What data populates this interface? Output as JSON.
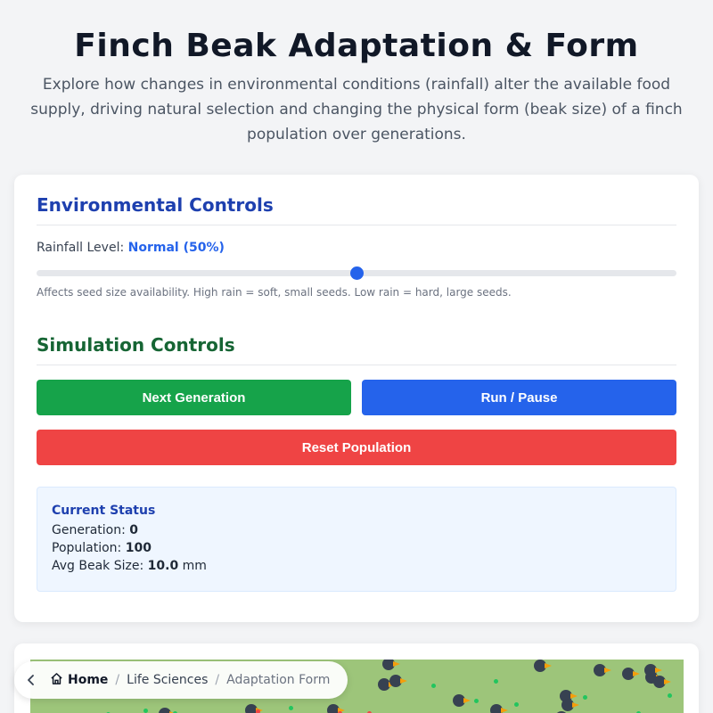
{
  "header": {
    "title": "Finch Beak Adaptation & Form",
    "subtitle": "Explore how changes in environmental conditions (rainfall) alter the available food supply, driving natural selection and changing the physical form (beak size) of a finch population over generations."
  },
  "environment": {
    "title": "Environmental Controls",
    "rainfall_label": "Rainfall Level:",
    "rainfall_value": "Normal (50%)",
    "rainfall_percent": 50,
    "hint": "Affects seed size availability. High rain = soft, small seeds. Low rain = hard, large seeds."
  },
  "simulation": {
    "title": "Simulation Controls",
    "next_label": "Next Generation",
    "run_label": "Run / Pause",
    "reset_label": "Reset Population"
  },
  "status": {
    "title": "Current Status",
    "generation_label": "Generation:",
    "generation_value": "0",
    "population_label": "Population:",
    "population_value": "100",
    "beak_label": "Avg Beak Size:",
    "beak_value": "10.0",
    "beak_unit": "mm"
  },
  "breadcrumb": {
    "home": "Home",
    "section": "Life Sciences",
    "current": "Adaptation Form"
  },
  "colors": {
    "accent_blue": "#2563eb",
    "next_green": "#16a34a",
    "reset_red": "#ef4444",
    "field_green": "#9dc57a",
    "finch_body": "#374151",
    "beak": "#f59e0b",
    "seed_small": "#22c55e",
    "seed_large": "#ef4444"
  },
  "icons": {
    "back": "chevron-left-icon",
    "home": "home-icon"
  }
}
